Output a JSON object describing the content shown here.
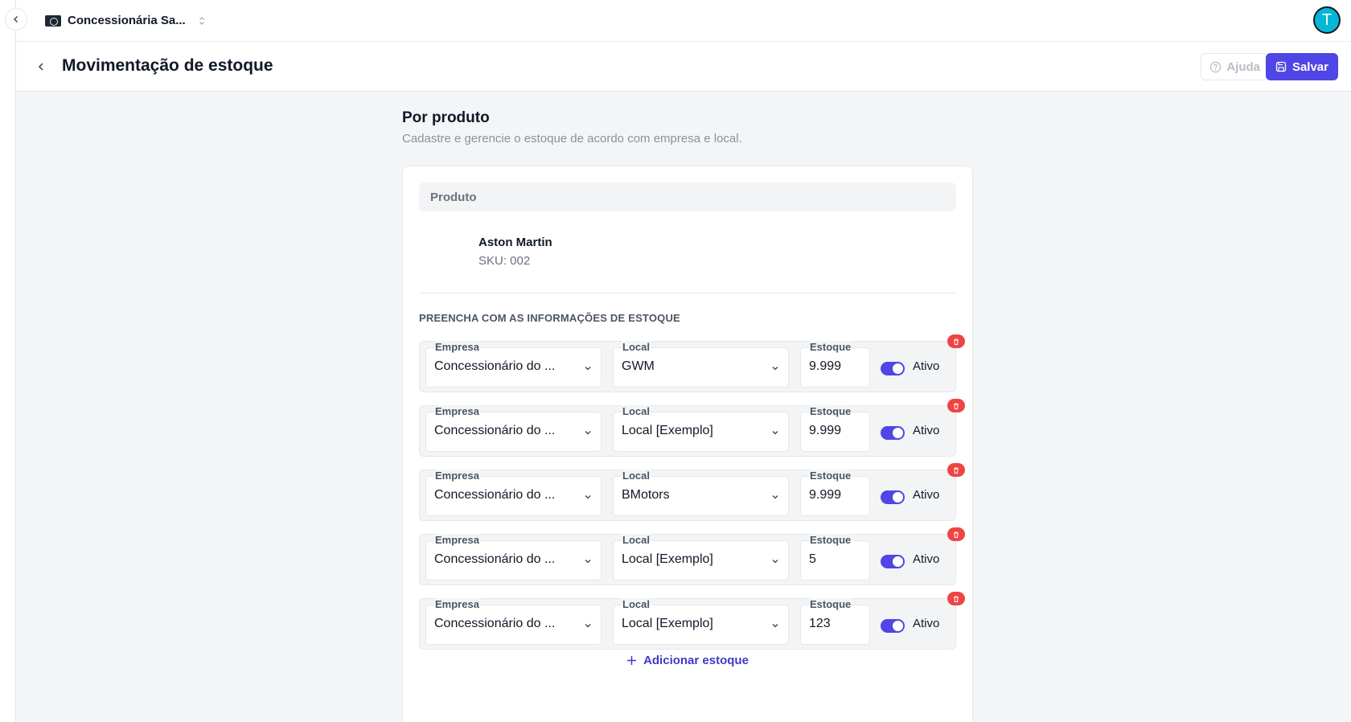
{
  "topbar": {
    "org_name": "Concessionária Sa...",
    "avatar_initial": "T"
  },
  "page": {
    "title": "Movimentação de estoque",
    "help_label": "Ajuda",
    "save_label": "Salvar"
  },
  "section": {
    "title": "Por produto",
    "subtitle": "Cadastre e gerencie o estoque de acordo com empresa e local."
  },
  "product": {
    "header": "Produto",
    "name": "Aston Martin",
    "sku": "SKU: 002"
  },
  "stock": {
    "heading": "PREENCHA COM AS INFORMAÇÕES DE ESTOQUE",
    "labels": {
      "empresa": "Empresa",
      "local": "Local",
      "estoque": "Estoque",
      "ativo": "Ativo"
    },
    "rows": [
      {
        "empresa": "Concessionário do ...",
        "local": "GWM",
        "estoque": "9.999",
        "ativo": true
      },
      {
        "empresa": "Concessionário do ...",
        "local": "Local [Exemplo]",
        "estoque": "9.999",
        "ativo": true
      },
      {
        "empresa": "Concessionário do ...",
        "local": "BMotors",
        "estoque": "9.999",
        "ativo": true
      },
      {
        "empresa": "Concessionário do ...",
        "local": "Local [Exemplo]",
        "estoque": "5",
        "ativo": true
      },
      {
        "empresa": "Concessionário do ...",
        "local": "Local [Exemplo]",
        "estoque": "123",
        "ativo": true
      }
    ],
    "add_label": "Adicionar estoque"
  },
  "colors": {
    "accent": "#4f46e5",
    "danger": "#ef4444",
    "avatar": "#06b6d4"
  }
}
